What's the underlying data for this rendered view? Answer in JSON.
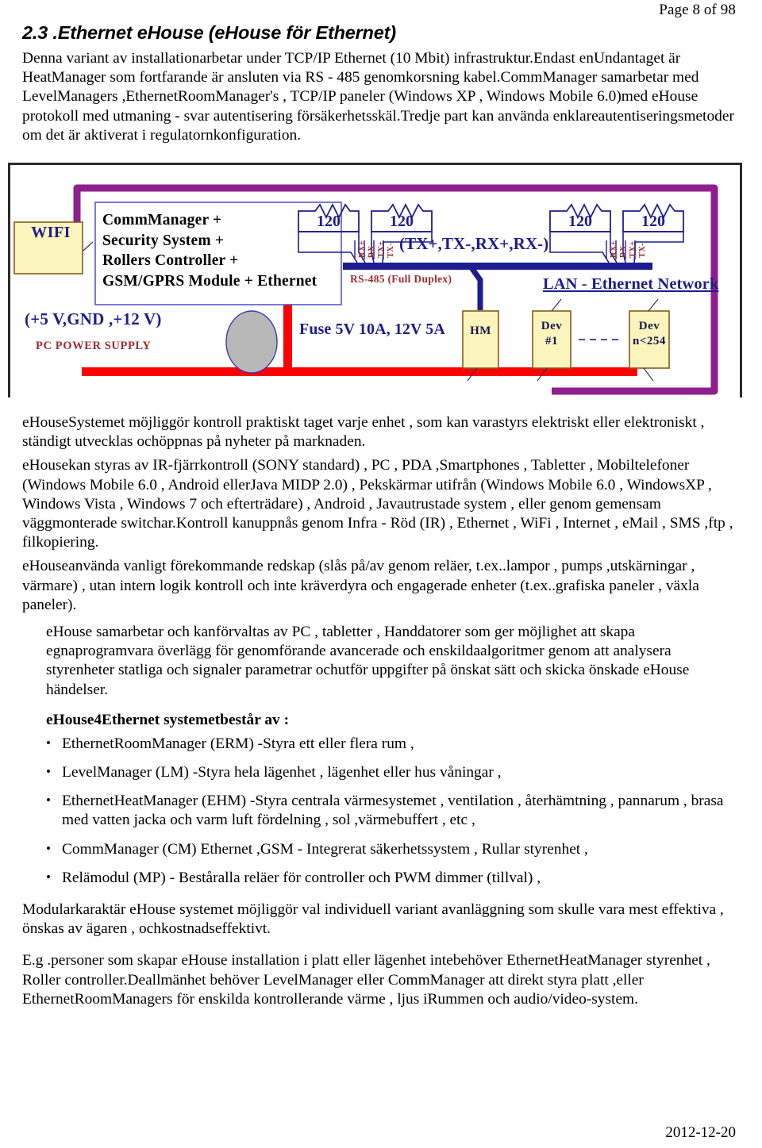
{
  "header": {
    "page_indicator": "Page 8 of 98"
  },
  "heading": {
    "text": "2.3 .Ethernet eHouse (eHouse för Ethernet)"
  },
  "intro": {
    "paragraph": "Denna variant av installationarbetar under TCP/IP Ethernet (10 Mbit) infrastruktur.Endast enUndantaget är HeatManager som fortfarande är ansluten via RS - 485 genomkorsning kabel.CommManager samarbetar med LevelManagers ,EthernetRoomManager's , TCP/IP paneler (Windows XP , Windows Mobile 6.0)med eHouse protokoll med utmaning - svar autentisering försäkerhetsskäl.Tredje part kan använda enklareautentiseringsmetoder om det är aktiverat i regulatornkonfiguration."
  },
  "diagram": {
    "wifi_box": "WIFI",
    "commmanager_box": "CommManager +\nSecurity System +\nRollers Controller +\nGSM/GPRS Module + Ethernet",
    "power_voltages": "(+5 V,GND ,+12 V)",
    "power_supply_label": "PC POWER SUPPLY",
    "fuse_label": "Fuse 5V 10A, 12V 5A",
    "rs485_label": "RS-485 (Full Duplex)",
    "txrx_label": "(TX+,TX-,RX+,RX-)",
    "lan_label": "LAN - Ethernet Network",
    "resistors": [
      "120",
      "120",
      "120",
      "120"
    ],
    "pin_labels": [
      "RX+",
      "RX-",
      "TX+",
      "TX-"
    ],
    "devices": [
      {
        "name": "hm-box",
        "line1": "HM",
        "line2": ""
      },
      {
        "name": "dev1-box",
        "line1": "Dev",
        "line2": "#1"
      },
      {
        "name": "devn-box",
        "line1": "Dev",
        "line2": "n<254"
      }
    ],
    "ellipsis": "- - - - - - - -",
    "colors": {
      "ethernet_bus": "#8f1f8f",
      "rs485_bus": "#1d1d8f",
      "power_bus": "#ff0000",
      "box_fill": "#fbf5bd",
      "box_border": "#8a5a1a",
      "frame": "#2b2b2b",
      "label_blue": "#1d1d8f",
      "label_red": "#9c2c2c"
    }
  },
  "body": {
    "p1": "eHouseSystemet möjliggör kontroll praktiskt taget varje enhet , som kan varastyrs elektriskt eller elektroniskt , ständigt utvecklas ochöppnas på nyheter på marknaden.",
    "p2": "eHousekan styras av IR-fjärrkontroll (SONY standard) , PC , PDA ,Smartphones , Tabletter , Mobiltelefoner (Windows Mobile 6.0 , Android ellerJava MIDP 2.0) , Pekskärmar utifrån (Windows Mobile 6.0 , WindowsXP , Windows Vista , Windows 7 och efterträdare) , Android , Javautrustade system , eller genom gemensam väggmonterade switchar.Kontroll kanuppnås genom Infra - Röd (IR) , Ethernet , WiFi , Internet , eMail , SMS ,ftp , filkopiering.",
    "p3": "eHouseanvända vanligt förekommande redskap (slås på/av genom reläer, t.ex..lampor , pumps ,utskärningar , värmare) , utan intern logik kontroll och inte kräverdyra och engagerade enheter (t.ex..grafiska paneler , växla paneler).",
    "p4": "eHouse samarbetar och kanförvaltas av PC , tabletter , Handdatorer som ger möjlighet att skapa egnaprogramvara överlägg för genomförande avancerade och enskildaalgoritmer genom att analysera styrenheter statliga och signaler parametrar ochutför uppgifter på önskat sätt och skicka önskade eHouse händelser."
  },
  "list_heading": "eHouse4Ethernet systemetbestår av :",
  "features": [
    "EthernetRoomManager (ERM) -Styra ett eller flera rum ,",
    "LevelManager (LM) -Styra hela lägenhet , lägenhet eller hus våningar ,",
    "EthernetHeatManager (EHM) -Styra centrala värmesystemet , ventilation , återhämtning , pannarum , brasa med vatten jacka och varm luft fördelning , sol ,värmebuffert , etc ,",
    "CommManager (CM) Ethernet ,GSM - Integrerat säkerhetssystem , Rullar styrenhet ,",
    "Relämodul (MP) - Beståralla reläer för controller och PWM dimmer (tillval) ,"
  ],
  "closing": {
    "p1": "Modularkaraktär eHouse systemet möjliggör val individuell variant avanläggning som skulle vara mest effektiva , önskas av ägaren , ochkostnadseffektivt.",
    "p2": "E.g .personer som skapar eHouse installation i platt eller lägenhet intebehöver EthernetHeatManager styrenhet , Roller controller.Deallmänhet behöver LevelManager eller CommManager att direkt styra platt ,eller EthernetRoomManagers för enskilda kontrollerande värme , ljus iRummen och audio/video-system."
  },
  "footer": {
    "date": "2012-12-20"
  }
}
